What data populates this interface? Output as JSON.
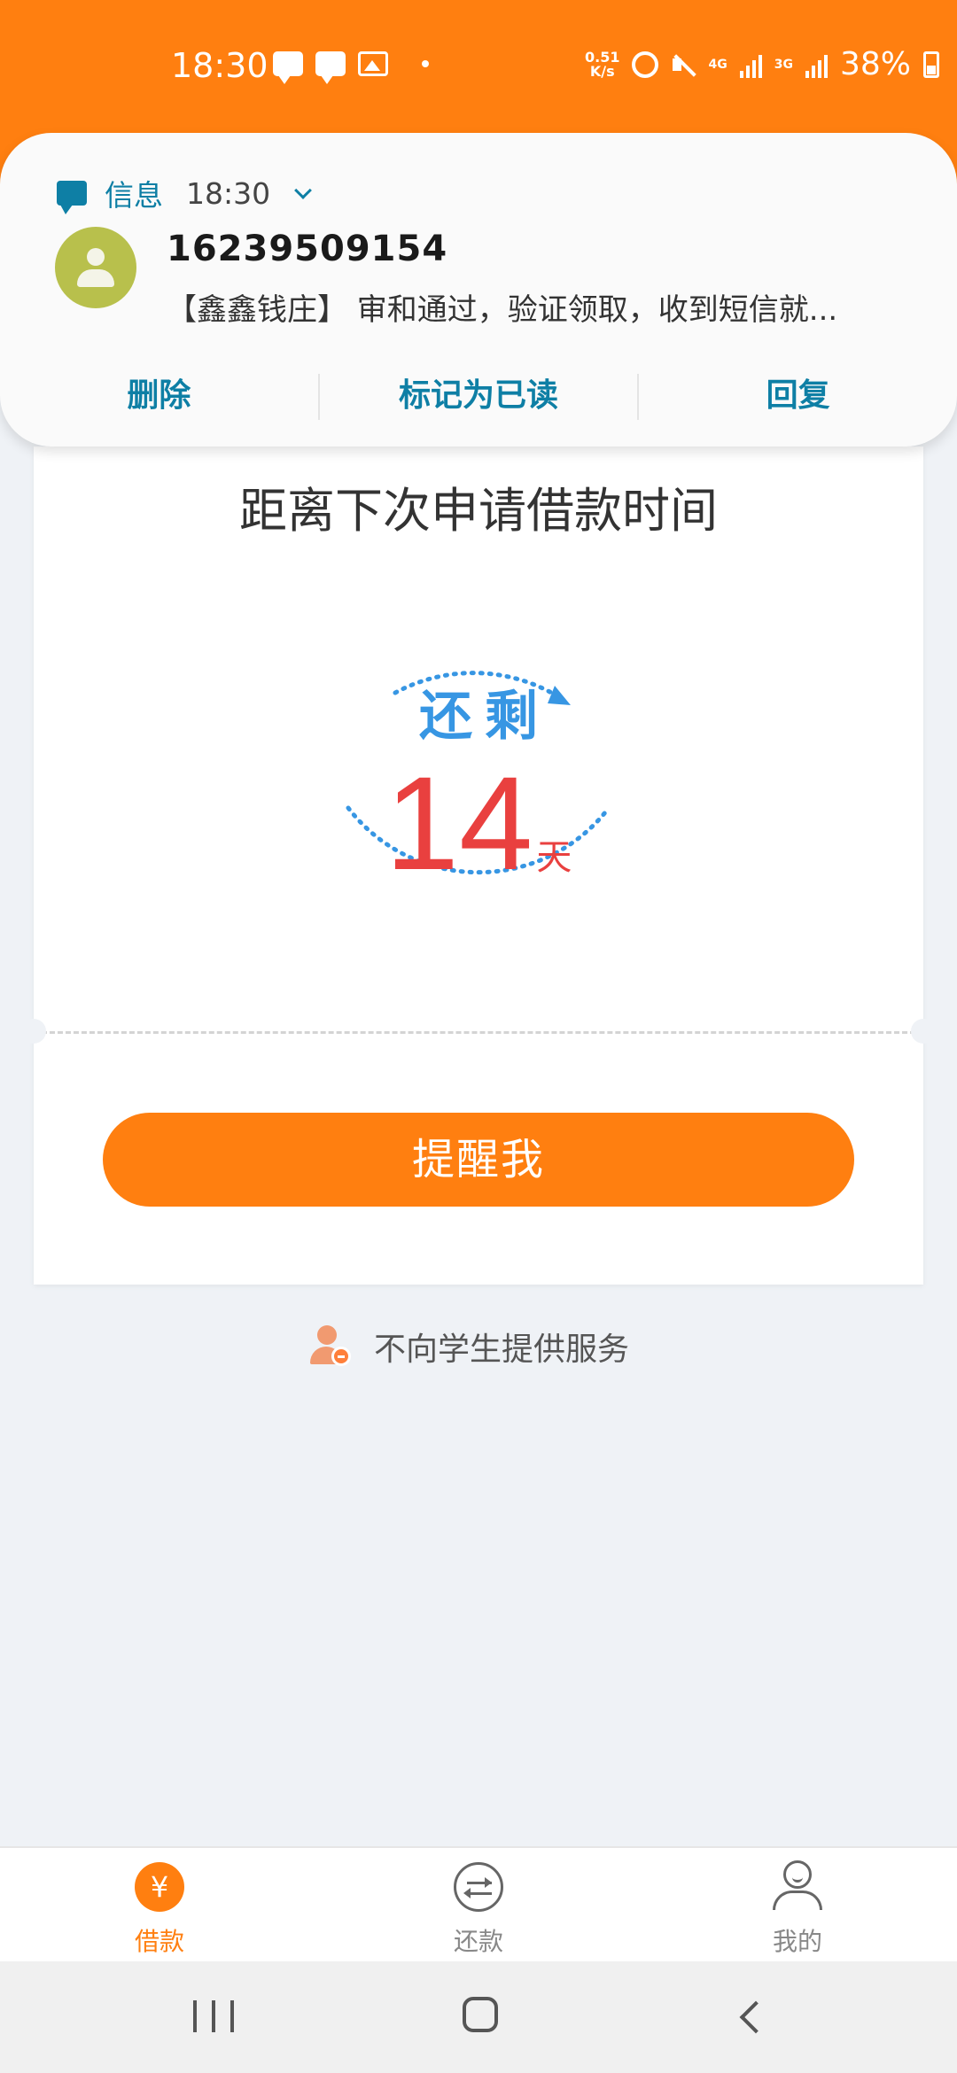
{
  "status_bar": {
    "time": "18:30",
    "net_speed_value": "0.51",
    "net_speed_unit": "K/s",
    "net_4g": "4G",
    "net_3g": "3G",
    "battery": "38%",
    "icons": [
      "message-icon",
      "message-icon",
      "image-icon",
      "dot-icon",
      "alarm-icon",
      "mute-icon",
      "signal-icon",
      "battery-icon"
    ]
  },
  "notification": {
    "app_name": "信息",
    "time": "18:30",
    "sender": "16239509154",
    "preview": "【鑫鑫钱庄】 审和通过，验证领取，收到短信就...",
    "actions": {
      "delete": "删除",
      "mark_read": "标记为已读",
      "reply": "回复"
    },
    "accent_color": "#0e7fa5"
  },
  "card": {
    "title": "距离下次申请借款时间",
    "remain_label": "还剩",
    "days": "14",
    "days_unit": "天",
    "button_label": "提醒我"
  },
  "note": {
    "text": "不向学生提供服务"
  },
  "tabs": [
    {
      "label": "借款",
      "icon": "yen-icon",
      "active": true
    },
    {
      "label": "还款",
      "icon": "exchange-icon",
      "active": false
    },
    {
      "label": "我的",
      "icon": "profile-icon",
      "active": false
    }
  ],
  "colors": {
    "brand_orange": "#ff7f10",
    "countdown_blue": "#3796e3",
    "countdown_red": "#e9403f",
    "background": "#eff2f6"
  }
}
